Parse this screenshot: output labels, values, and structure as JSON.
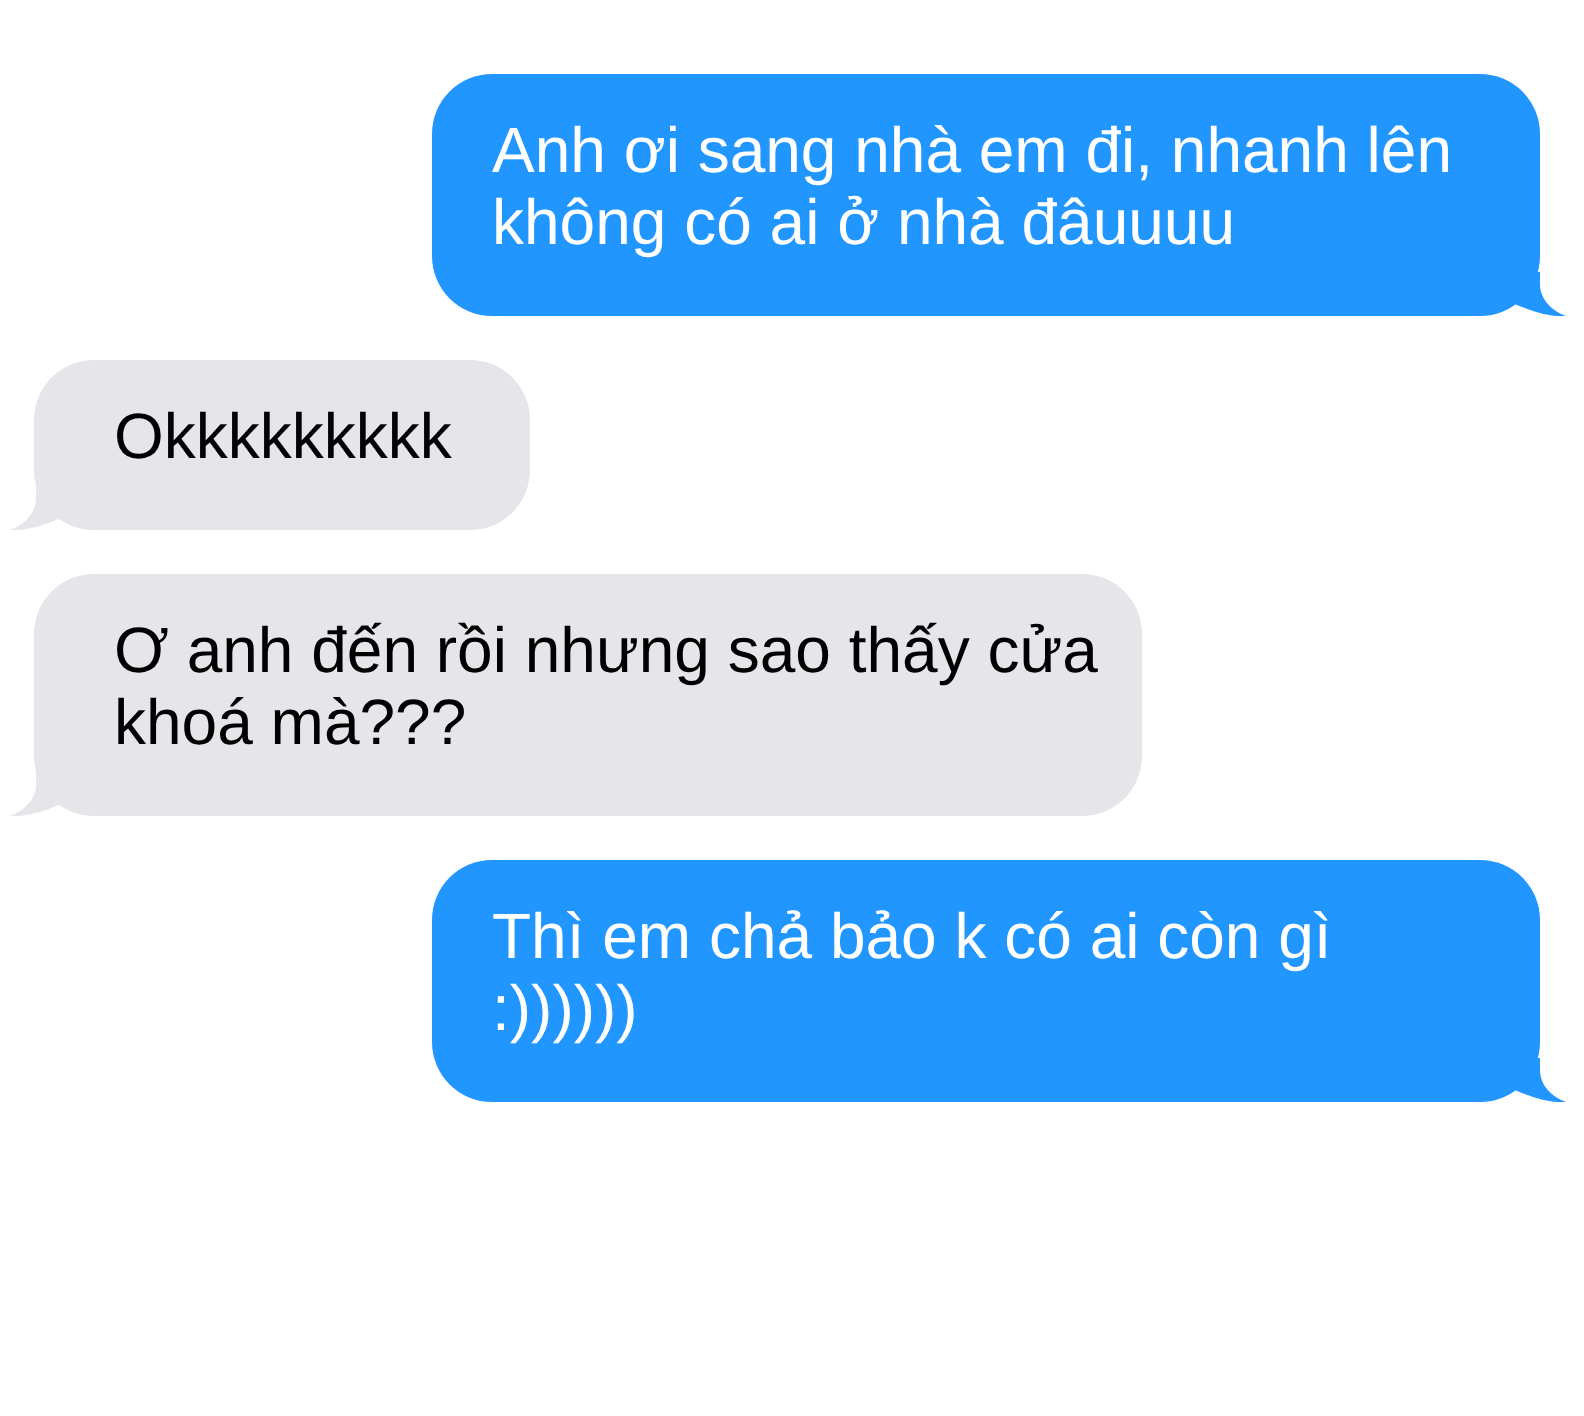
{
  "messages": [
    {
      "kind": "sent",
      "lines": [
        "Anh ơi sang nhà em đi, nhanh lên",
        "không có ai ở nhà đâuuuu"
      ]
    },
    {
      "kind": "received",
      "lines": [
        "Okkkkkkkkk"
      ]
    },
    {
      "kind": "received",
      "lines": [
        "Ơ anh đến rồi nhưng sao thấy cửa",
        "khoá mà???"
      ]
    },
    {
      "kind": "sent",
      "lines": [
        "Thì em chả bảo k có ai còn gì",
        ":))))))"
      ]
    }
  ]
}
